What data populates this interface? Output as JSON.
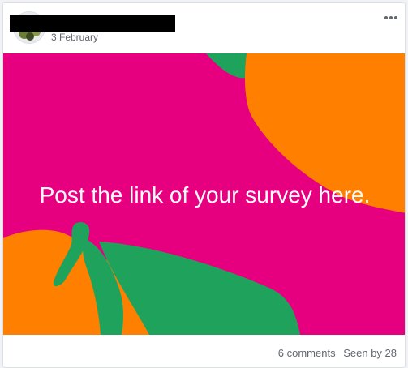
{
  "post": {
    "date": "3 February",
    "image_caption": "Post the link of your survey here.",
    "comments_count": "6 comments",
    "seen_by": "Seen by 28"
  },
  "icons": {
    "avatar": "profile-photo",
    "more": "more-options-icon"
  },
  "colors": {
    "image_background": "#e6007f",
    "fruit_orange": "#ff7f00",
    "leaf_green": "#1fa35c",
    "meta_text": "#616770"
  }
}
